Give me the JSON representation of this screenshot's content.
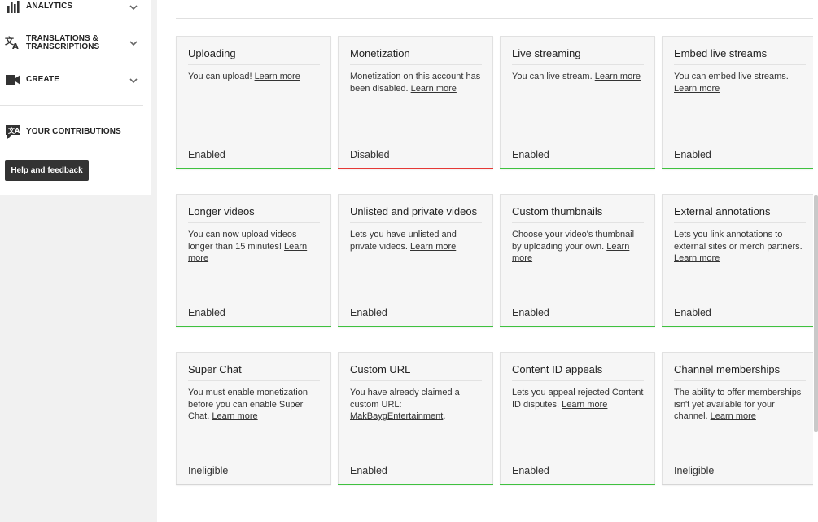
{
  "sidebar": {
    "items": [
      {
        "label": "ANALYTICS",
        "icon": "bar-chart-icon",
        "expandable": true
      },
      {
        "label": "TRANSLATIONS & TRANSCRIPTIONS",
        "icon": "translate-icon",
        "expandable": true
      },
      {
        "label": "CREATE",
        "icon": "video-camera-icon",
        "expandable": true
      },
      {
        "label": "YOUR CONTRIBUTIONS",
        "icon": "contributions-icon",
        "expandable": false
      }
    ],
    "help_button": "Help and feedback"
  },
  "colors": {
    "enabled": "#3fc13f",
    "disabled": "#e53935",
    "ineligible": "#d6d6d6"
  },
  "features": [
    {
      "title": "Uploading",
      "desc": "You can upload!",
      "link": "Learn more",
      "status": "Enabled",
      "state": "enabled"
    },
    {
      "title": "Monetization",
      "desc": "Monetization on this account has been disabled.",
      "link": "Learn more",
      "status": "Disabled",
      "state": "disabled"
    },
    {
      "title": "Live streaming",
      "desc": "You can live stream.",
      "link": "Learn more",
      "status": "Enabled",
      "state": "enabled"
    },
    {
      "title": "Embed live streams",
      "desc": "You can embed live streams.",
      "link": "Learn more",
      "status": "Enabled",
      "state": "enabled"
    },
    {
      "title": "Longer videos",
      "desc": "You can now upload videos longer than 15 minutes!",
      "link": "Learn more",
      "status": "Enabled",
      "state": "enabled"
    },
    {
      "title": "Unlisted and private videos",
      "desc": "Lets you have unlisted and private videos.",
      "link": "Learn more",
      "status": "Enabled",
      "state": "enabled"
    },
    {
      "title": "Custom thumbnails",
      "desc": "Choose your video's thumbnail by uploading your own.",
      "link": "Learn more",
      "status": "Enabled",
      "state": "enabled"
    },
    {
      "title": "External annotations",
      "desc": "Lets you link annotations to external sites or merch partners.",
      "link": "Learn more",
      "status": "Enabled",
      "state": "enabled"
    },
    {
      "title": "Super Chat",
      "desc": "You must enable monetization before you can enable Super Chat.",
      "link": "Learn more",
      "status": "Ineligible",
      "state": "ineligible"
    },
    {
      "title": "Custom URL",
      "desc": "You have already claimed a custom URL:",
      "link": "MakBaygEntertainment",
      "link_suffix": ".",
      "status": "Enabled",
      "state": "enabled"
    },
    {
      "title": "Content ID appeals",
      "desc": "Lets you appeal rejected Content ID disputes.",
      "link": "Learn more",
      "status": "Enabled",
      "state": "enabled"
    },
    {
      "title": "Channel memberships",
      "desc": "The ability to offer memberships isn't yet available for your channel.",
      "link": "Learn more",
      "status": "Ineligible",
      "state": "ineligible"
    }
  ]
}
